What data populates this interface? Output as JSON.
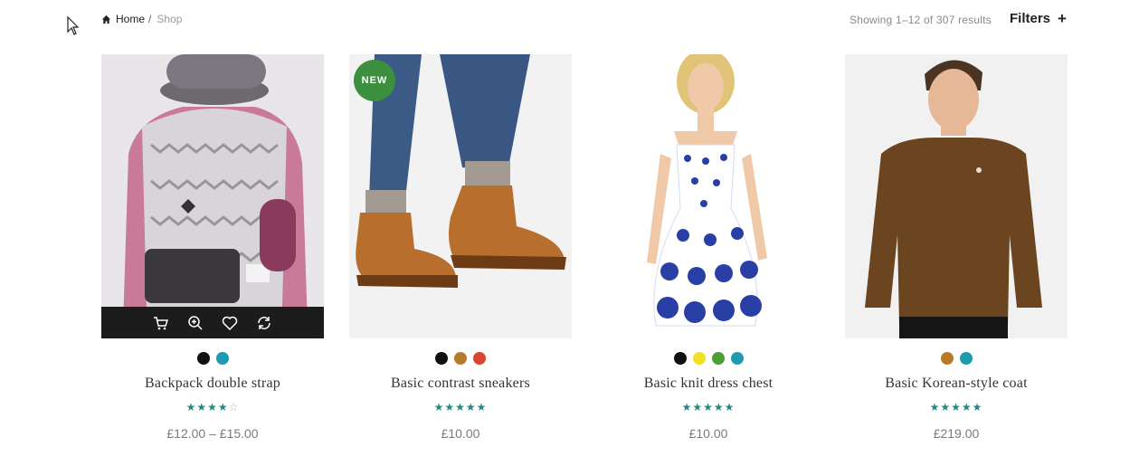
{
  "breadcrumb": {
    "home": "Home",
    "separator": "/",
    "current": "Shop"
  },
  "result_count": "Showing 1–12 of 307 results",
  "filters": {
    "label": "Filters",
    "icon": "+"
  },
  "actions": {
    "cart": "cart-icon",
    "zoom": "zoom-icon",
    "wishlist": "heart-icon",
    "compare": "refresh-icon"
  },
  "products": [
    {
      "name": "Backpack double strap",
      "price": "£12.00 – £15.00",
      "rating": 4,
      "badge": "",
      "swatches": [
        "#111111",
        "#1f9bb0"
      ]
    },
    {
      "name": "Basic contrast sneakers",
      "price": "£10.00",
      "rating": 5,
      "badge": "NEW",
      "swatches": [
        "#111111",
        "#b87a2a",
        "#d9452f"
      ]
    },
    {
      "name": "Basic knit dress chest",
      "price": "£10.00",
      "rating": 5,
      "badge": "",
      "swatches": [
        "#111111",
        "#f2e024",
        "#4a9e35",
        "#1f9bb0"
      ]
    },
    {
      "name": "Basic Korean-style coat",
      "price": "£219.00",
      "rating": 5,
      "badge": "",
      "swatches": [
        "#b87a2a",
        "#1f9bb0"
      ]
    }
  ]
}
